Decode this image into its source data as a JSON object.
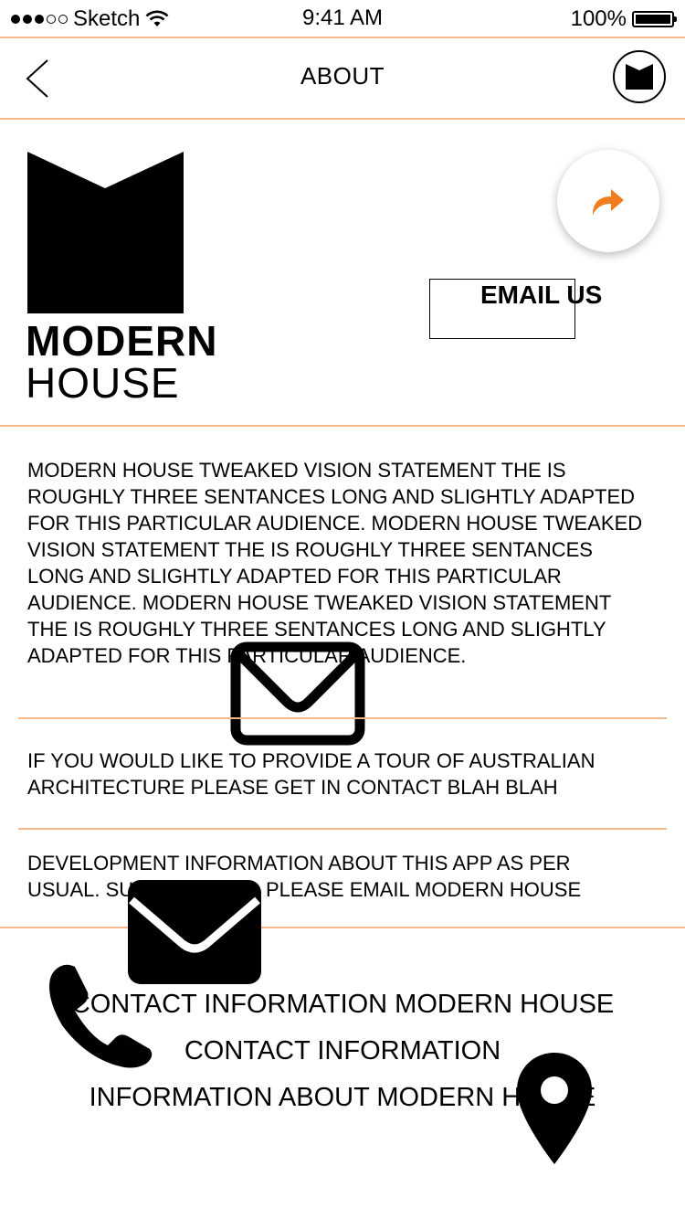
{
  "status_bar": {
    "carrier": "Sketch",
    "time": "9:41 AM",
    "battery": "100%"
  },
  "nav": {
    "title": "ABOUT",
    "back_icon": "chevron-left-icon",
    "logo_icon": "modern-house-logo-icon"
  },
  "brand": {
    "line1": "MODERN",
    "line2": "HOUSE"
  },
  "actions": {
    "share_icon": "share-arrow-icon",
    "share_color": "#f07c1e",
    "email_label": "EMAIL US"
  },
  "content": {
    "vision": "MODERN HOUSE TWEAKED VISION STATEMENT THE IS ROUGHLY THREE SENTANCES LONG AND SLIGHTLY ADAPTED FOR THIS PARTICULAR AUDIENCE. MODERN HOUSE TWEAKED VISION STATEMENT THE IS ROUGHLY THREE SENTANCES LONG AND SLIGHTLY ADAPTED FOR THIS PARTICULAR AUDIENCE. MODERN HOUSE TWEAKED VISION STATEMENT THE IS ROUGHLY THREE SENTANCES LONG AND SLIGHTLY ADAPTED FOR THIS PARTICULAR AUDIENCE.",
    "tour": "IF YOU WOULD LIKE TO PROVIDE A TOUR OF AUSTRALIAN ARCHITECTURE PLEASE GET IN CONTACT BLAH BLAH",
    "dev_line1": "DEVELOPMENT INFORMATION ABOUT THIS APP AS PER",
    "dev_line2_start": "USUAL. SU",
    "dev_line2_end": "PLEASE EMAIL MODERN HOUSE"
  },
  "contact": {
    "line1": "CONTACT INFORMATION MODERN HOUSE",
    "line2": "CONTACT INFORMATION",
    "line3": "INFORMATION ABOUT MODERN HOUSE"
  },
  "icons": {
    "mail_outline": "mail-outline-icon",
    "mail_filled": "mail-filled-icon",
    "phone": "phone-icon",
    "location": "location-pin-icon"
  },
  "colors": {
    "divider": "#f3b98b",
    "accent": "#f07c1e"
  }
}
